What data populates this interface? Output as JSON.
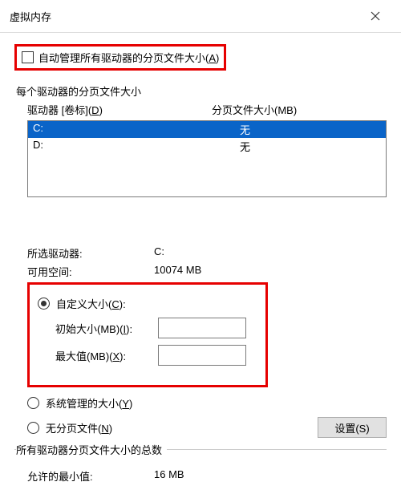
{
  "window": {
    "title": "虚拟内存"
  },
  "autoManage": {
    "label_pre": "自动管理所有驱动器的分页文件大小(",
    "accel": "A",
    "label_post": ")"
  },
  "group1": {
    "title": "每个驱动器的分页文件大小",
    "header_drive_pre": "驱动器 [卷标](",
    "header_drive_accel": "D",
    "header_drive_post": ")",
    "header_size": "分页文件大小(MB)",
    "rows": [
      {
        "drive": "C:",
        "size": "无"
      },
      {
        "drive": "D:",
        "size": "无"
      }
    ],
    "selected_label": "所选驱动器:",
    "selected_value": "C:",
    "space_label": "可用空间:",
    "space_value": "10074 MB"
  },
  "sizeOptions": {
    "custom_pre": "自定义大小(",
    "custom_accel": "C",
    "custom_post": "):",
    "initial_pre": "初始大小(MB)(",
    "initial_accel": "I",
    "initial_post": "):",
    "max_pre": "最大值(MB)(",
    "max_accel": "X",
    "max_post": "):",
    "initial_value": "",
    "max_value": "",
    "system_pre": "系统管理的大小(",
    "system_accel": "Y",
    "system_post": ")",
    "none_pre": "无分页文件(",
    "none_accel": "N",
    "none_post": ")",
    "set_label": "设置(S)"
  },
  "totals": {
    "title": "所有驱动器分页文件大小的总数",
    "min_label": "允许的最小值:",
    "min_value": "16 MB"
  }
}
